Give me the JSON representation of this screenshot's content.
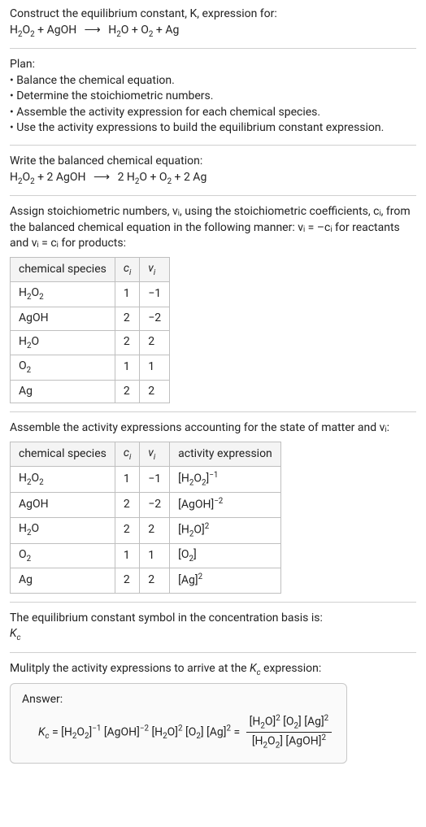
{
  "intro": {
    "line1": "Construct the equilibrium constant, K, expression for:",
    "equation_left_1": "H",
    "equation_left_1b": "O",
    "equation_plus1": " + AgOH",
    "arrow": "⟶",
    "equation_right_1": "H",
    "equation_right_1b": "O + O",
    "equation_plus2": " + Ag"
  },
  "plan": {
    "title": "Plan:",
    "b1": "• Balance the chemical equation.",
    "b2": "• Determine the stoichiometric numbers.",
    "b3": "• Assemble the activity expression for each chemical species.",
    "b4": "• Use the activity expressions to build the equilibrium constant expression."
  },
  "balanced": {
    "title": "Write the balanced chemical equation:",
    "seg1": "H",
    "seg2": "O",
    "seg3": " + 2 AgOH",
    "arrow": "⟶",
    "seg4": " 2 H",
    "seg5": "O + O",
    "seg6": " + 2 Ag"
  },
  "assign": {
    "title": "Assign stoichiometric numbers, νᵢ, using the stoichiometric coefficients, cᵢ, from the balanced chemical equation in the following manner: νᵢ = –cᵢ for reactants and νᵢ = cᵢ for products:"
  },
  "table1": {
    "h0": "chemical species",
    "h1": "cᵢ",
    "h2": "νᵢ",
    "rows": [
      {
        "sp_a": "H",
        "sp_b": "O",
        "ci": "1",
        "vi": "−1",
        "has_sub": true,
        "sub1": "2",
        "sub2": "2"
      },
      {
        "sp_a": "AgOH",
        "sp_b": "",
        "ci": "2",
        "vi": "−2",
        "has_sub": false
      },
      {
        "sp_a": "H",
        "sp_b": "O",
        "ci": "2",
        "vi": "2",
        "has_sub": true,
        "sub1": "2",
        "sub2": ""
      },
      {
        "sp_a": "O",
        "sp_b": "",
        "ci": "1",
        "vi": "1",
        "has_sub": true,
        "sub1": "2",
        "sub2": ""
      },
      {
        "sp_a": "Ag",
        "sp_b": "",
        "ci": "2",
        "vi": "2",
        "has_sub": false
      }
    ]
  },
  "assemble": {
    "title": "Assemble the activity expressions accounting for the state of matter and νᵢ:"
  },
  "table2": {
    "h0": "chemical species",
    "h1": "cᵢ",
    "h2": "νᵢ",
    "h3": "activity expression"
  },
  "t2": {
    "r0": {
      "ci": "1",
      "vi": "−1"
    },
    "r1": {
      "ci": "2",
      "vi": "−2"
    },
    "r2": {
      "ci": "2",
      "vi": "2"
    },
    "r3": {
      "ci": "1",
      "vi": "1"
    },
    "r4": {
      "ci": "2",
      "vi": "2"
    }
  },
  "eqsym": {
    "line1": "The equilibrium constant symbol in the concentration basis is:",
    "line2": "K",
    "line2sub": "c"
  },
  "mult": {
    "title": "Mulitply the activity expressions to arrive at the K꜀ expression:"
  },
  "answer": {
    "label": "Answer:"
  },
  "chart_data": {
    "type": "table",
    "species": [
      {
        "name": "H2O2",
        "c_i": 1,
        "nu_i": -1,
        "activity": "[H2O2]^-1"
      },
      {
        "name": "AgOH",
        "c_i": 2,
        "nu_i": -2,
        "activity": "[AgOH]^-2"
      },
      {
        "name": "H2O",
        "c_i": 2,
        "nu_i": 2,
        "activity": "[H2O]^2"
      },
      {
        "name": "O2",
        "c_i": 1,
        "nu_i": 1,
        "activity": "[O2]"
      },
      {
        "name": "Ag",
        "c_i": 2,
        "nu_i": 2,
        "activity": "[Ag]^2"
      }
    ],
    "balanced_equation": "H2O2 + 2 AgOH -> 2 H2O + O2 + 2 Ag",
    "Kc_expression": "Kc = [H2O2]^-1 [AgOH]^-2 [H2O]^2 [O2] [Ag]^2 = ([H2O]^2 [O2] [Ag]^2) / ([H2O2] [AgOH]^2)"
  }
}
